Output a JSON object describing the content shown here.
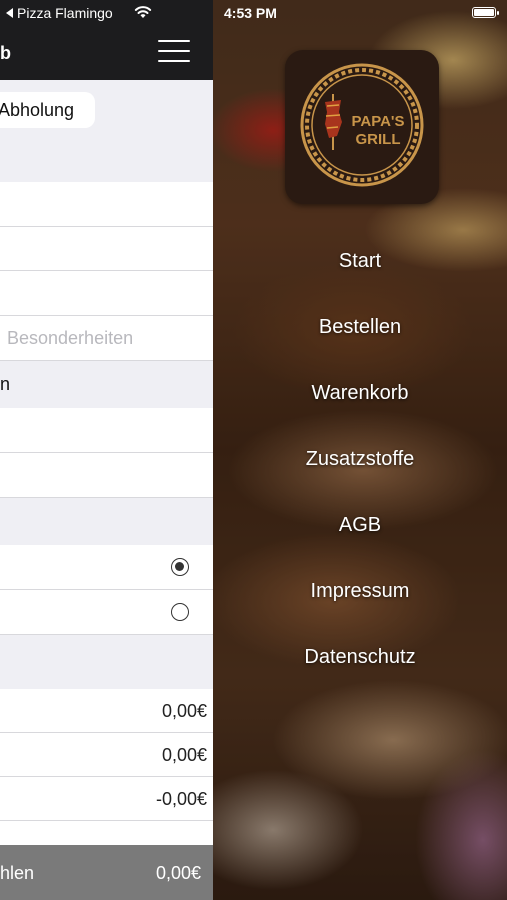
{
  "status_bar": {
    "back_app": "Pizza Flamingo",
    "time": "4:53 PM"
  },
  "header": {
    "title": "b"
  },
  "order": {
    "mode_label": "Abholung",
    "notes_placeholder": "Besonderheiten",
    "section_label": "n",
    "prices": [
      "0,00€",
      "0,00€",
      "-0,00€"
    ]
  },
  "checkout": {
    "label": "hlen",
    "amount": "0,00€"
  },
  "logo": {
    "line1": "PAPA'S",
    "line2": "GRILL"
  },
  "menu": {
    "items": [
      {
        "label": "Start"
      },
      {
        "label": "Bestellen"
      },
      {
        "label": "Warenkorb"
      },
      {
        "label": "Zusatzstoffe"
      },
      {
        "label": "AGB"
      },
      {
        "label": "Impressum"
      },
      {
        "label": "Datenschutz"
      }
    ]
  },
  "colors": {
    "navbar": "#1c1c1e",
    "panel_bg": "#efeff4",
    "checkout_bg": "#7a7a7a",
    "logo_gold": "#c8954a"
  }
}
